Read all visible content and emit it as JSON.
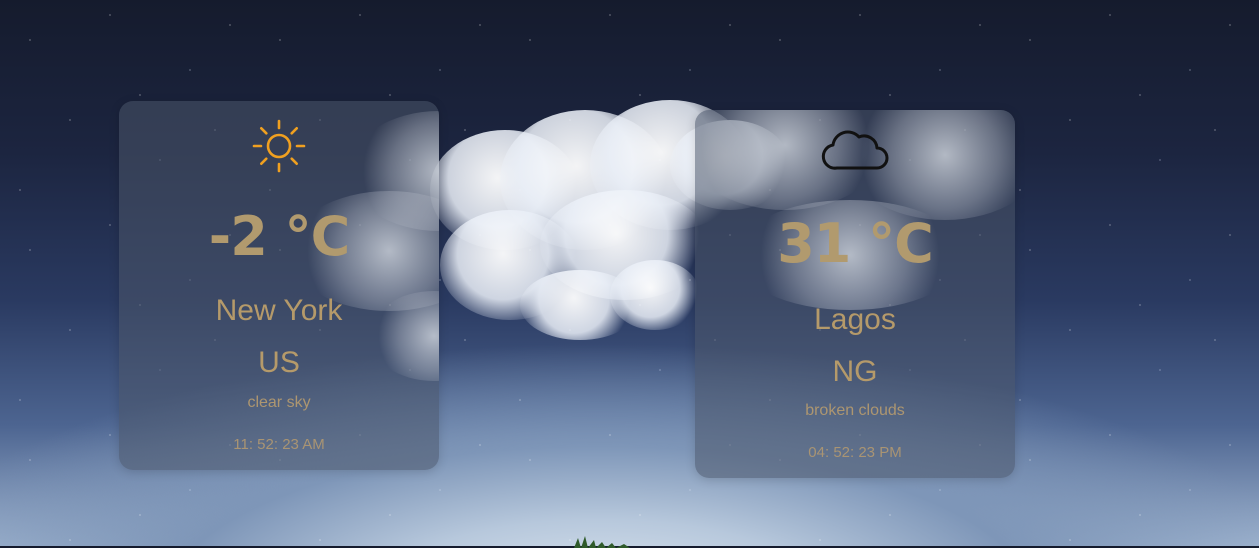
{
  "cards": [
    {
      "temperature": "-2 °C",
      "city": "New York",
      "country": "US",
      "description": "clear sky",
      "time": "11: 52: 23 AM",
      "icon": "sun-icon"
    },
    {
      "temperature": "31 °C",
      "city": "Lagos",
      "country": "NG",
      "description": "broken clouds",
      "time": "04: 52: 23 PM",
      "icon": "cloud-icon"
    }
  ],
  "colors": {
    "text_gold": "#b59a6a",
    "sun_orange": "#f0a020",
    "card_bg": "rgba(75,85,105,0.55)"
  }
}
